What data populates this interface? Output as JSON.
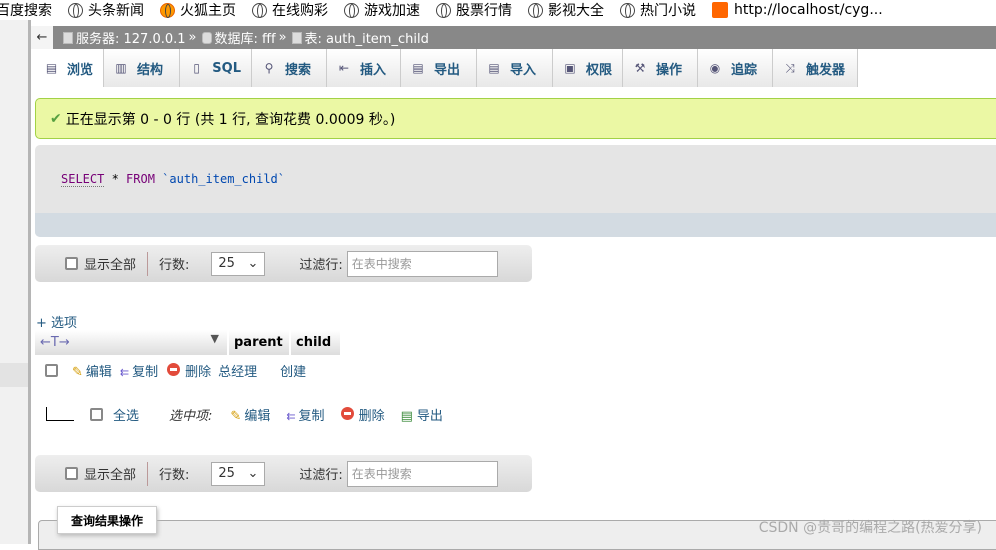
{
  "bookmarks": [
    "百度搜索",
    "头条新闻",
    "火狐主页",
    "在线购彩",
    "游戏加速",
    "股票行情",
    "影视大全",
    "热门小说",
    "http://localhost/cyg..."
  ],
  "breadcrumb": {
    "server": "服务器: 127.0.0.1",
    "sep": "»",
    "database": "数据库: fff",
    "table": "表: auth_item_child"
  },
  "tabs": [
    "浏览",
    "结构",
    "SQL",
    "搜索",
    "插入",
    "导出",
    "导入",
    "权限",
    "操作",
    "追踪",
    "触发器"
  ],
  "success_message": "正在显示第 0 - 0 行 (共 1 行, 查询花费 0.0009 秒。)",
  "sql": {
    "select": "SELECT",
    "star": " * ",
    "from": "FROM",
    "table": " `auth_item_child`"
  },
  "toolbar": {
    "show_all": "显示全部",
    "rows_label": "行数:",
    "rows_value": "25",
    "filter_label": "过滤行:",
    "filter_placeholder": "在表中搜索"
  },
  "options_link": "+ 选项",
  "table": {
    "columns": [
      "parent",
      "child"
    ],
    "rows": [
      {
        "parent": "总经理",
        "child": "创建"
      }
    ],
    "actions": {
      "edit": "编辑",
      "copy": "复制",
      "delete": "删除"
    }
  },
  "bulk": {
    "check_all": "全选",
    "with_selected": "选中项:",
    "edit": "编辑",
    "copy": "复制",
    "delete": "删除",
    "export": "导出"
  },
  "legend": "查询结果操作",
  "watermark": "CSDN @贵哥的编程之路(热爱分享)"
}
